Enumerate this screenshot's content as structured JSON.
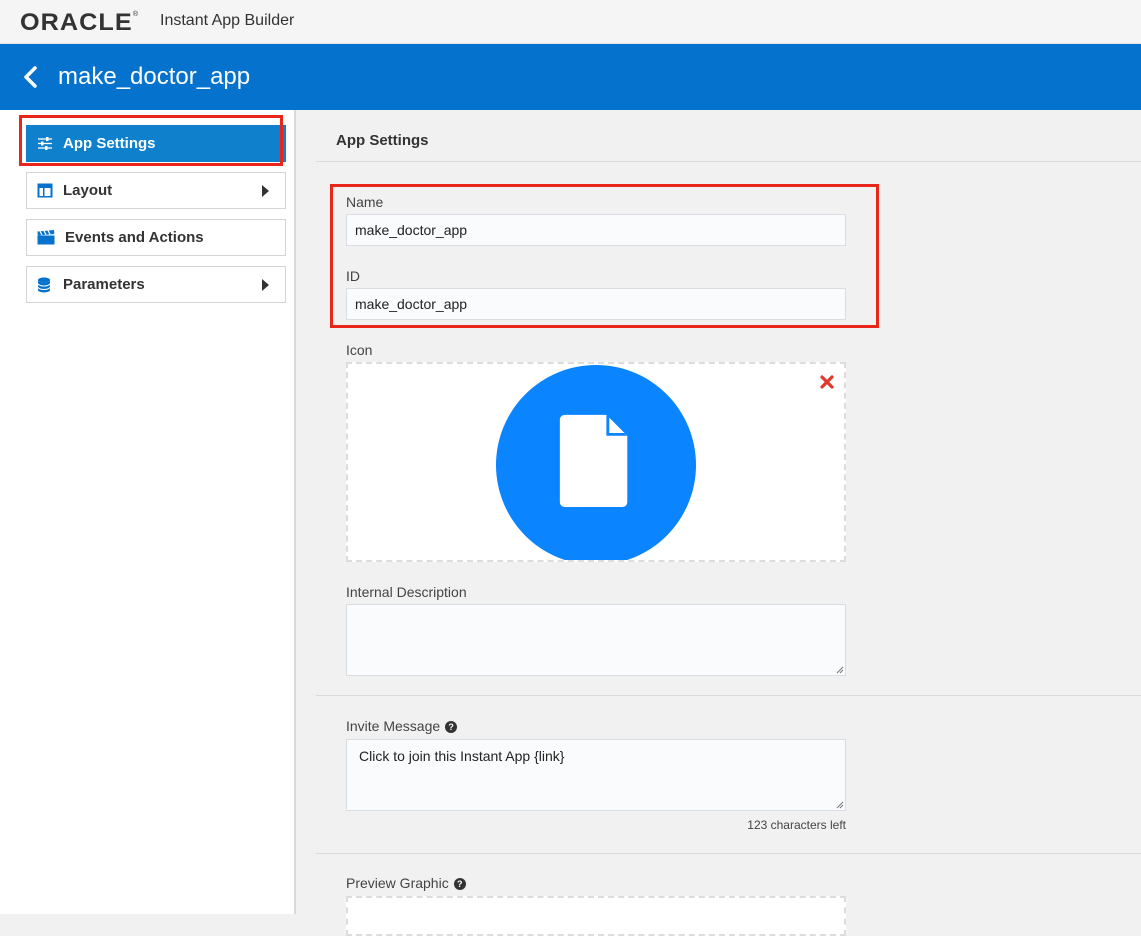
{
  "header": {
    "brand": "ORACLE",
    "brand_mark": "®",
    "product": "Instant App Builder"
  },
  "appbar": {
    "back_icon": "chevron-left-icon",
    "title": "make_doctor_app"
  },
  "sidebar": {
    "items": [
      {
        "label": "App Settings",
        "icon": "sliders-icon",
        "active": true,
        "has_submenu": false
      },
      {
        "label": "Layout",
        "icon": "layout-icon",
        "active": false,
        "has_submenu": true
      },
      {
        "label": "Events and Actions",
        "icon": "clapperboard-icon",
        "active": false,
        "has_submenu": false
      },
      {
        "label": "Parameters",
        "icon": "database-icon",
        "active": false,
        "has_submenu": true
      }
    ]
  },
  "main": {
    "title": "App Settings",
    "name_label": "Name",
    "name_value": "make_doctor_app",
    "id_label": "ID",
    "id_value": "make_doctor_app",
    "icon_label": "Icon",
    "icon_image": "document-icon",
    "internal_description_label": "Internal Description",
    "internal_description_value": "",
    "invite_message_label": "Invite Message",
    "invite_message_value": "Click to join this Instant App {link}",
    "characters_left": "123 characters left",
    "preview_graphic_label": "Preview Graphic"
  },
  "colors": {
    "appbar": "#0572ce",
    "active_nav": "#0e80cc",
    "highlight": "#e8271a",
    "icon_circle": "#0a84ff",
    "delete": "#e0392c"
  }
}
